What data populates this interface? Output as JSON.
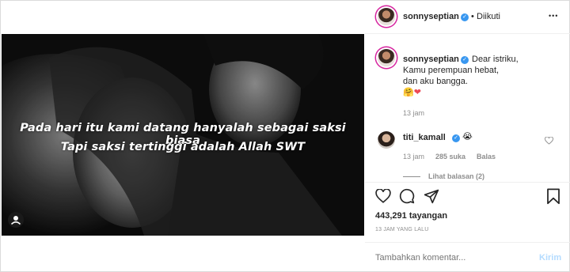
{
  "post": {
    "image_caption": {
      "line1": "Pada hari itu kami datang hanyalah sebagai saksi biasa",
      "line2": "Tapi saksi tertinggi adalah Allah SWT"
    }
  },
  "header": {
    "username": "sonnyseptian",
    "separator": "•",
    "follow_status": "Diikuti",
    "more": "•••"
  },
  "owner_comment": {
    "username": "sonnyseptian",
    "lines": [
      "Dear istriku,",
      "Kamu perempuan hebat,",
      "dan aku bangga."
    ],
    "emojis": "🤗❤",
    "time": "13 jam"
  },
  "comments": [
    {
      "username": "titi_kamall",
      "text": "😭",
      "time": "13 jam",
      "likes": "285 suka",
      "reply_label": "Balas",
      "view_replies": "Lihat balasan (2)"
    }
  ],
  "stats": {
    "views": "443,291 tayangan",
    "timestamp": "13 JAM YANG LALU"
  },
  "comment_box": {
    "placeholder": "Tambahkan komentar...",
    "submit_label": "Kirim"
  },
  "colors": {
    "verified": "#3897f0",
    "heart": "#ed4956",
    "submit_disabled": "#b3dbff"
  }
}
